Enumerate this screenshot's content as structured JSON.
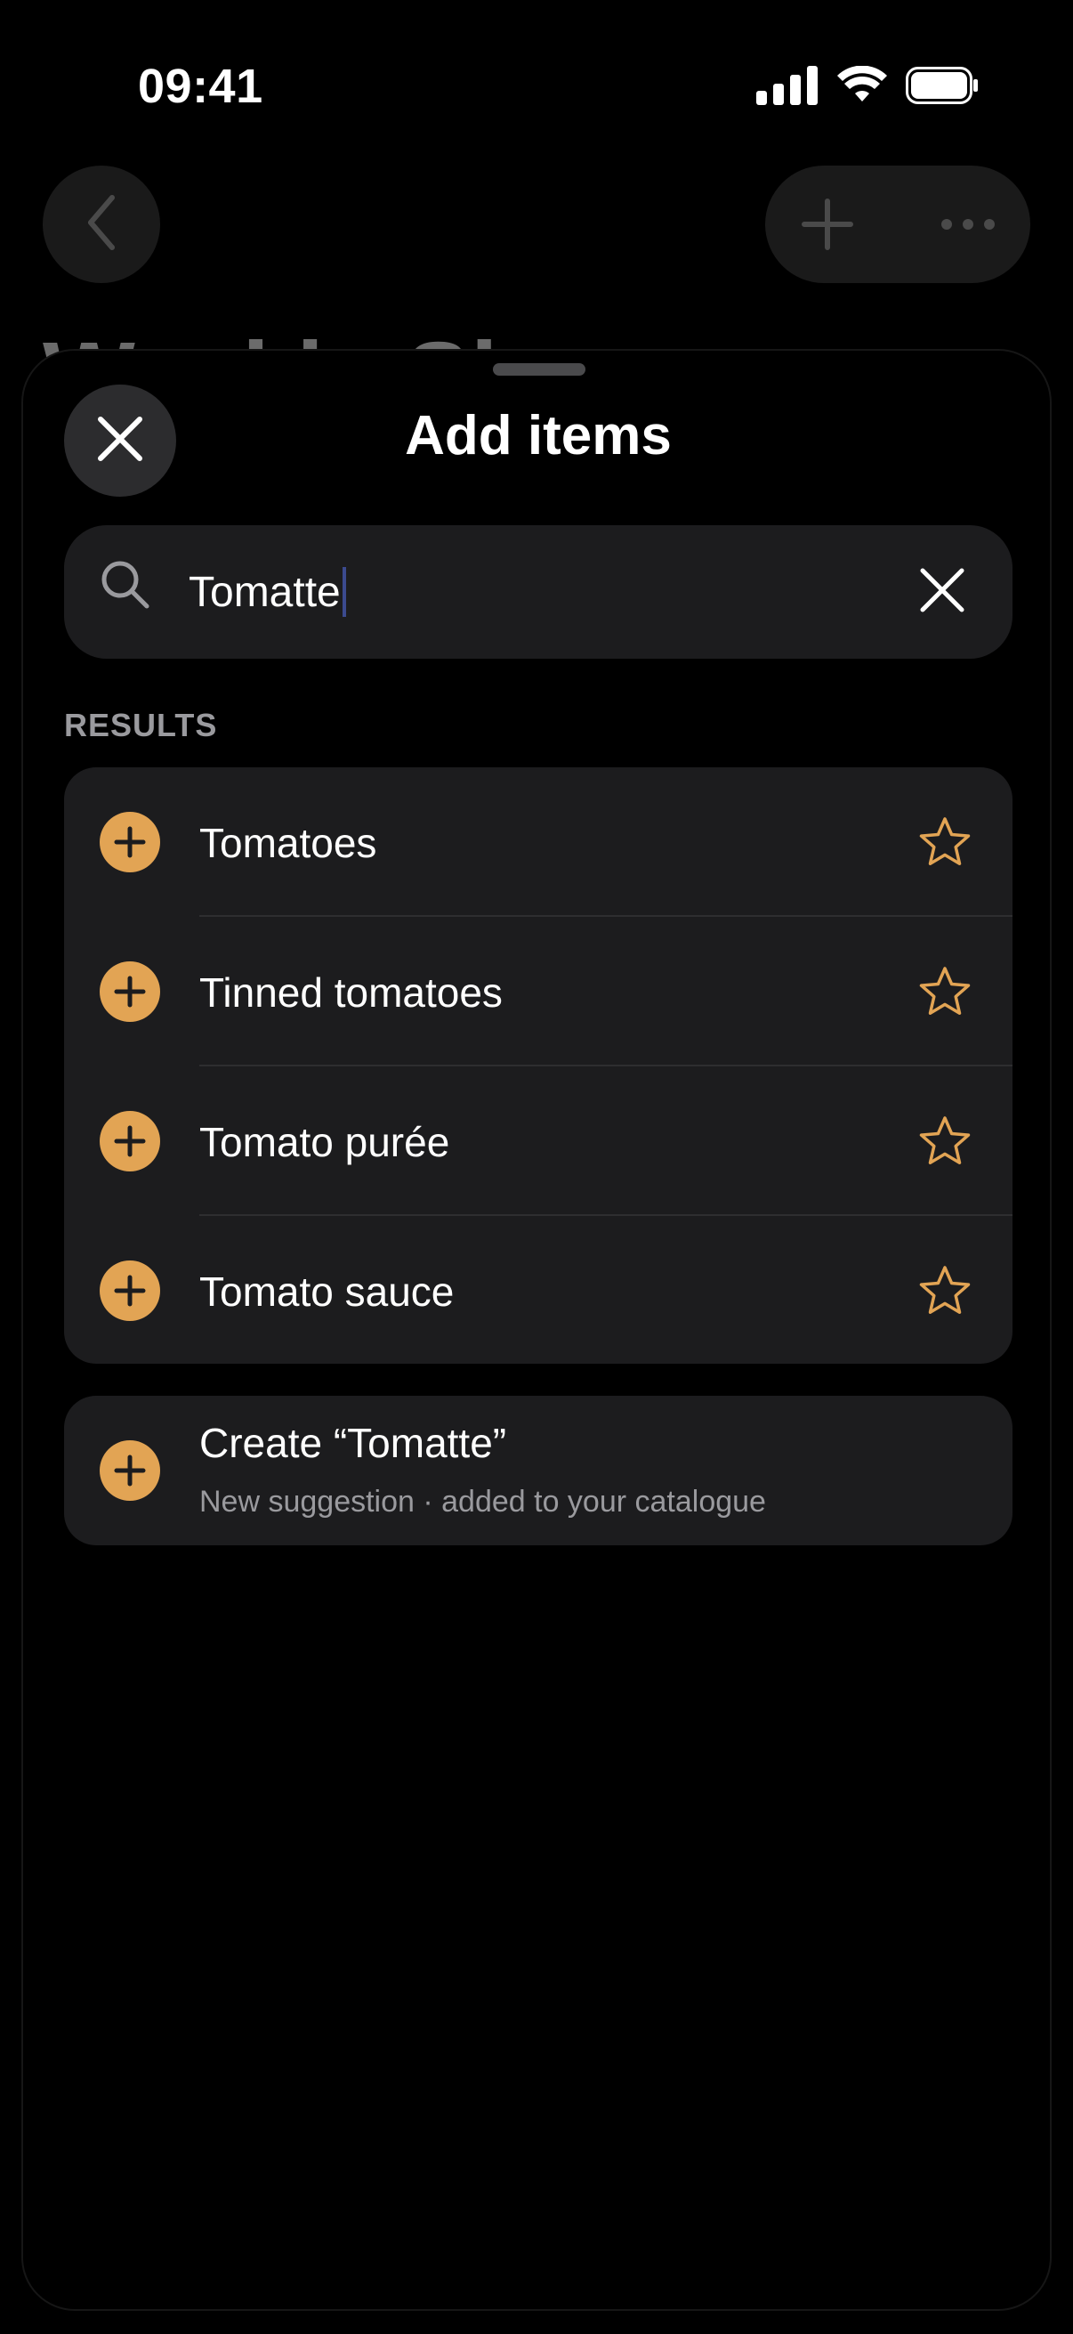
{
  "status_bar": {
    "time": "09:41"
  },
  "background_page": {
    "title": "Weekly Shop"
  },
  "sheet": {
    "title": "Add items"
  },
  "search": {
    "value": "Tomatte"
  },
  "results": {
    "header": "RESULTS",
    "items": [
      {
        "label": "Tomatoes"
      },
      {
        "label": "Tinned tomatoes"
      },
      {
        "label": "Tomato purée"
      },
      {
        "label": "Tomato sauce"
      }
    ]
  },
  "create": {
    "title": "Create “Tomatte”",
    "subtitle": "New suggestion · added to your catalogue"
  },
  "colors": {
    "accent": "#e2a454",
    "background": "#000000",
    "surface": "#1c1c1e",
    "secondary_text": "#9a9a9e"
  },
  "icons": {
    "close": "close-icon",
    "search": "search-icon",
    "clear": "clear-icon",
    "add": "plus-icon",
    "favorite": "star-icon",
    "back": "chevron-left-icon",
    "more": "more-icon"
  }
}
